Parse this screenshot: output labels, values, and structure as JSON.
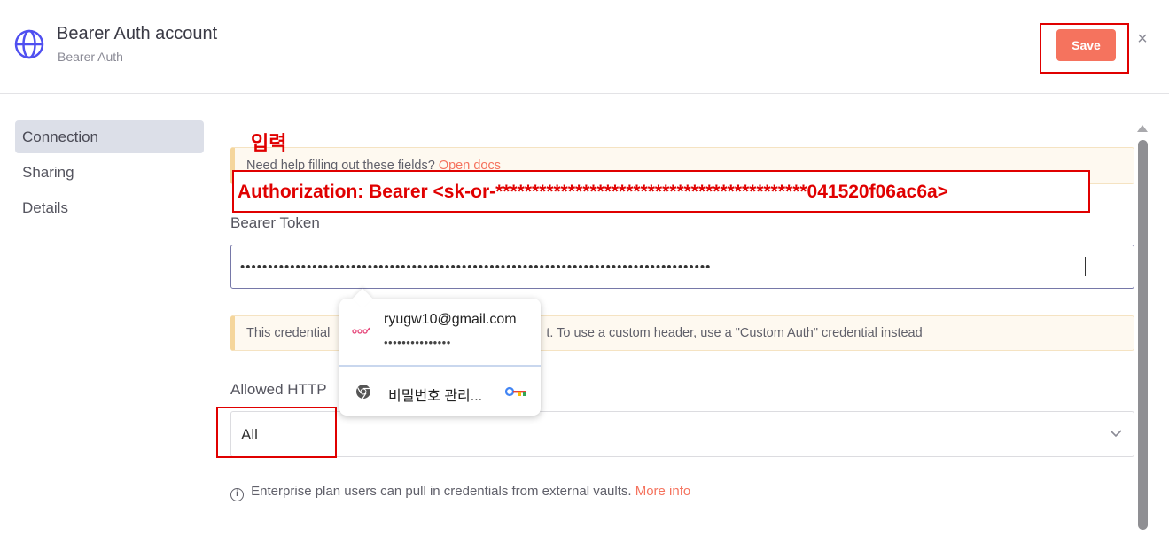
{
  "header": {
    "title": "Bearer Auth account",
    "subtitle": "Bearer Auth",
    "save_label": "Save",
    "close_symbol": "×",
    "icon": "globe-icon"
  },
  "nav": {
    "items": [
      {
        "label": "Connection",
        "active": true
      },
      {
        "label": "Sharing",
        "active": false
      },
      {
        "label": "Details",
        "active": false
      }
    ]
  },
  "annotations": {
    "korean_label": "입력",
    "auth_header": "Authorization: Bearer <sk-or-*******************************************041520f06ac6a>"
  },
  "help_notice": {
    "text": "Need help filling out these fields?",
    "link": "Open docs"
  },
  "bearer_token": {
    "label": "Bearer Token",
    "value": "•••••••••••••••••••••••••••••••••••••••••••••••••••••••••••••••••••••••••••••••••••••"
  },
  "credential_notice": {
    "text_start": "This credential",
    "text_end": "t. To use a custom header, use a \"Custom Auth\" credential instead"
  },
  "allowed_http": {
    "label": "Allowed HTTP",
    "selected": "All"
  },
  "footer": {
    "text": "Enterprise plan users can pull in credentials from external vaults.",
    "link": "More info"
  },
  "password_popup": {
    "email": "ryugw10@gmail.com",
    "password_dots": "•••••••••••••••",
    "manager_label": "비밀번호 관리..."
  },
  "colors": {
    "accent": "#f5735e",
    "annotation_red": "#e00000",
    "nav_active_bg": "#dcdfe8",
    "notice_bg": "#fef9f0",
    "globe": "#4f4ff0"
  }
}
